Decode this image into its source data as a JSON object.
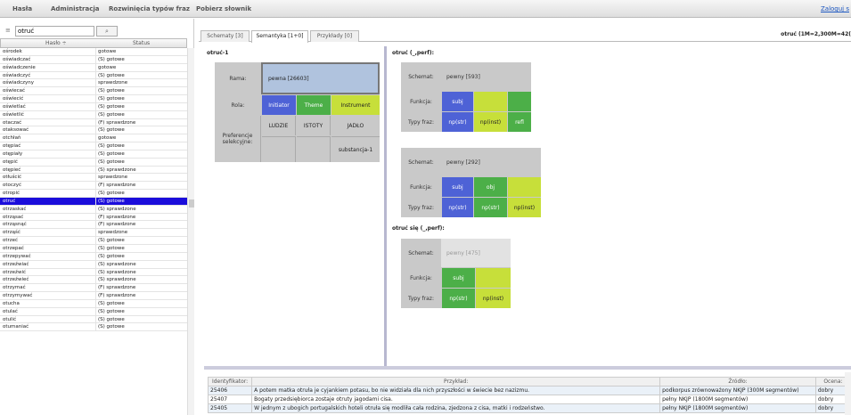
{
  "menu": {
    "items": [
      "Hasła",
      "Administracja",
      "Rozwinięcia typów fraz",
      "Pobierz słownik"
    ],
    "login": "Zaloguj s"
  },
  "search": {
    "filter_icon": "≡",
    "value": "otruć",
    "button_icon": "⌕"
  },
  "table": {
    "headers": [
      "Hasło ÷",
      "Status"
    ],
    "rows": [
      [
        "ośrodek",
        "gotowe"
      ],
      [
        "oświadczać",
        "(S) gotowe"
      ],
      [
        "oświadczenie",
        "gotowe"
      ],
      [
        "oświadczyć",
        "(S) gotowe"
      ],
      [
        "oświadczyny",
        "sprawdzone"
      ],
      [
        "oświecać",
        "(S) gotowe"
      ],
      [
        "oświecić",
        "(S) gotowe"
      ],
      [
        "oświetlać",
        "(S) gotowe"
      ],
      [
        "oświetlić",
        "(S) gotowe"
      ],
      [
        "otaczać",
        "(F) sprawdzone"
      ],
      [
        "otaksować",
        "(S) gotowe"
      ],
      [
        "otchłań",
        "gotowe"
      ],
      [
        "otępiać",
        "(S) gotowe"
      ],
      [
        "otępiały",
        "(S) gotowe"
      ],
      [
        "otępić",
        "(S) gotowe"
      ],
      [
        "otępieć",
        "(S) sprawdzone"
      ],
      [
        "otłuścić",
        "sprawdzone"
      ],
      [
        "otoczyć",
        "(F) sprawdzone"
      ],
      [
        "otropić",
        "(S) gotowe"
      ],
      [
        "otruć",
        "(S) gotowe"
      ],
      [
        "otrzaskać",
        "(S) sprawdzone"
      ],
      [
        "otrząsać",
        "(F) sprawdzone"
      ],
      [
        "otrząsnąć",
        "(F) sprawdzone"
      ],
      [
        "otrząść",
        "sprawdzone"
      ],
      [
        "otrzeć",
        "(S) gotowe"
      ],
      [
        "otrzepać",
        "(S) gotowe"
      ],
      [
        "otrzepywać",
        "(S) gotowe"
      ],
      [
        "otrzeźwiać",
        "(S) sprawdzone"
      ],
      [
        "otrzeźwić",
        "(S) sprawdzone"
      ],
      [
        "otrzeźwieć",
        "(S) sprawdzone"
      ],
      [
        "otrzymać",
        "(F) sprawdzone"
      ],
      [
        "otrzymywać",
        "(F) sprawdzone"
      ],
      [
        "otucha",
        "(S) gotowe"
      ],
      [
        "otulać",
        "(S) gotowe"
      ],
      [
        "otulić",
        "(S) gotowe"
      ],
      [
        "otumaniać",
        "(S) gotowe"
      ]
    ],
    "selected_index": 19
  },
  "tabs": [
    "Schematy [3]",
    "Semantyka [1+0]",
    "Przykłady [0]"
  ],
  "entry_header": "otruć (1M=2,300M=42(",
  "frame": {
    "title": "otruć-1",
    "rama_label": "Rama:",
    "rama_value": "pewna [26603]",
    "rola_label": "Rola:",
    "roles": [
      "Initiator",
      "Theme",
      "Instrument"
    ],
    "pref_label": "Preferencje selekcyjne:",
    "prefs": [
      "LUDZIE",
      "ISTOTY",
      "JADŁO"
    ],
    "pref_extra": "substancja-1"
  },
  "schemata": {
    "group1_title": "otruć (_,perf):",
    "group2_title": "otruć się (_,perf):",
    "labels": {
      "schemat": "Schemat:",
      "funkcja": "Funkcja:",
      "typy": "Typy fraz:"
    },
    "s1": {
      "schemat": "pewny [593]",
      "f": [
        "subj",
        "",
        "",
        ""
      ],
      "t": [
        "np(str)",
        "np(inst)",
        "refl"
      ]
    },
    "s2": {
      "schemat": "pewny [292]",
      "f": [
        "subj",
        "obj",
        ""
      ],
      "t": [
        "np(str)",
        "np(str)",
        "np(inst)"
      ]
    },
    "s3": {
      "schemat": "pewny [475]",
      "f": [
        "subj",
        ""
      ],
      "t": [
        "np(str)",
        "np(inst)"
      ]
    }
  },
  "examples": {
    "headers": [
      "Identyfikator:",
      "Przykład:",
      "Źródło:",
      "Ocena:"
    ],
    "rows": [
      [
        "25406",
        "A potem matka otruła je cyjankiem potasu, bo nie widziała dla nich przyszłości w świecie bez nazizmu.",
        "podkorpus zrównoważony NKJP (300M segmentów)",
        "dobry"
      ],
      [
        "25407",
        "Bogaty przedsiębiorca zostaje otruty jagodami cisa.",
        "pełny NKJP (1800M segmentów)",
        "dobry"
      ],
      [
        "25405",
        "W jednym z ubogich portugalskich hoteli otruła się modliła cała rodzina, zjedzona z cisa, matki i rodzeństwo.",
        "pełny NKJP (1800M segmentów)",
        "dobry"
      ]
    ]
  }
}
